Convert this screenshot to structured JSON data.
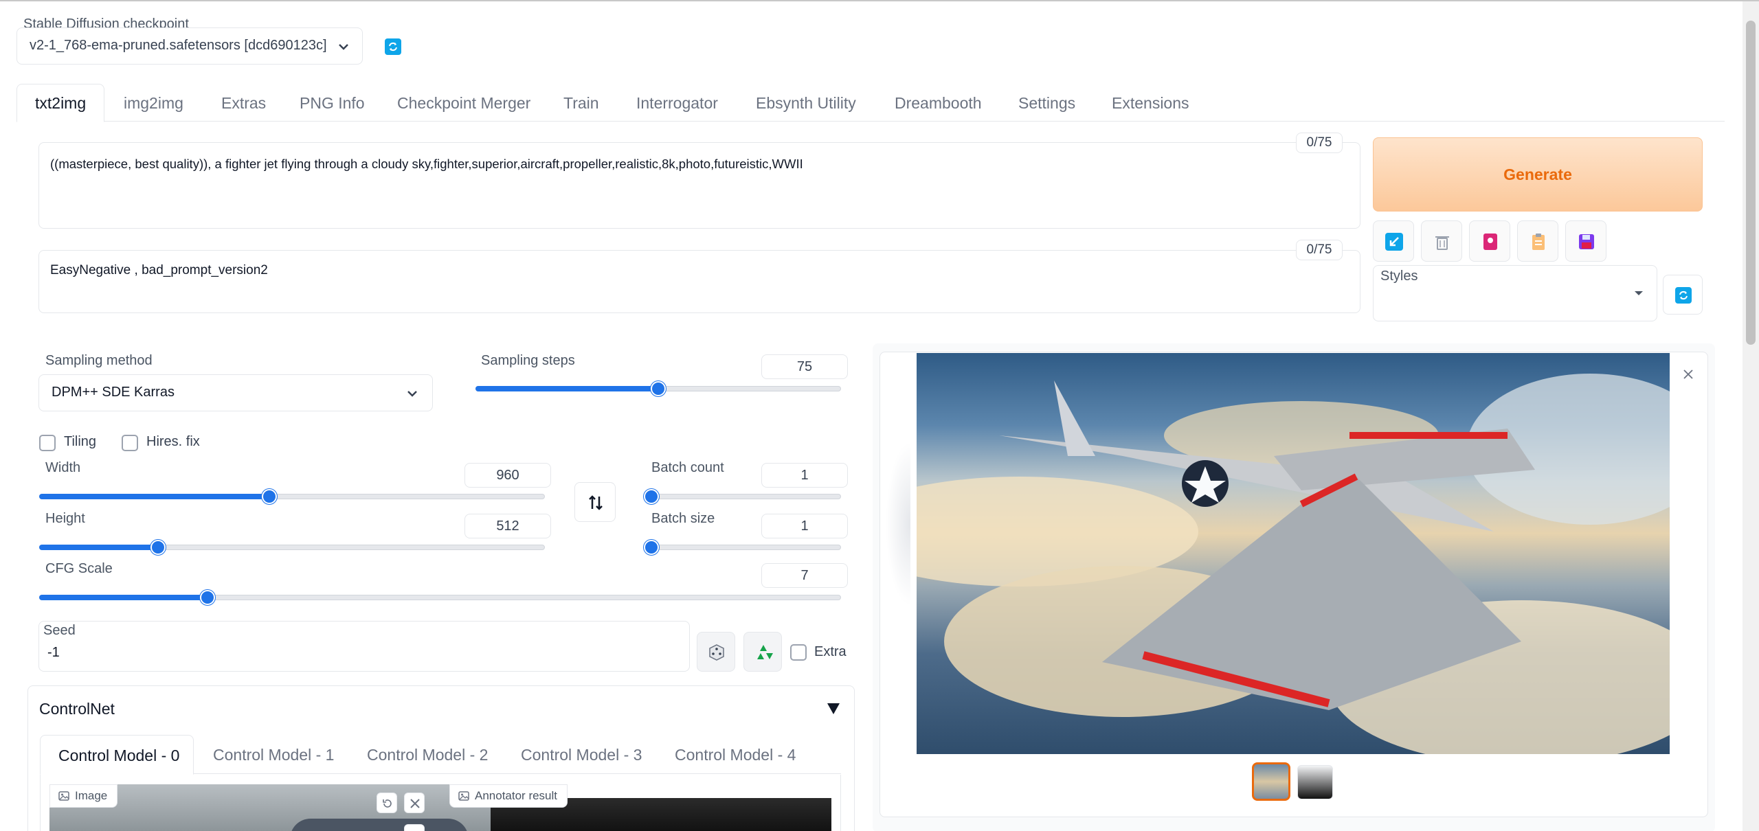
{
  "checkpoint": {
    "label": "Stable Diffusion checkpoint",
    "value": "v2-1_768-ema-pruned.safetensors [dcd690123c]"
  },
  "tabs": [
    "txt2img",
    "img2img",
    "Extras",
    "PNG Info",
    "Checkpoint Merger",
    "Train",
    "Interrogator",
    "Ebsynth Utility",
    "Dreambooth",
    "Settings",
    "Extensions"
  ],
  "prompt": {
    "text": "((masterpiece, best quality)), a fighter jet flying through a cloudy sky,fighter,superior,aircraft,propeller,realistic,8k,photo,futureistic,WWII",
    "counter": "0/75"
  },
  "negative_prompt": {
    "text": "EasyNegative , bad_prompt_version2",
    "counter": "0/75"
  },
  "generate_label": "Generate",
  "styles_label": "Styles",
  "sampling": {
    "method_label": "Sampling method",
    "method_value": "DPM++ SDE Karras",
    "steps_label": "Sampling steps",
    "steps_value": "75",
    "steps_fraction": 0.5
  },
  "tiling_label": "Tiling",
  "hires_label": "Hires. fix",
  "width": {
    "label": "Width",
    "value": "960",
    "fraction": 0.455
  },
  "height": {
    "label": "Height",
    "value": "512",
    "fraction": 0.235
  },
  "batch_count": {
    "label": "Batch count",
    "value": "1",
    "fraction": 0.0
  },
  "batch_size": {
    "label": "Batch size",
    "value": "1",
    "fraction": 0.0
  },
  "cfg": {
    "label": "CFG Scale",
    "value": "7",
    "fraction": 0.21
  },
  "seed": {
    "label": "Seed",
    "value": "-1",
    "extra_label": "Extra"
  },
  "controlnet": {
    "title": "ControlNet",
    "tabs": [
      "Control Model - 0",
      "Control Model - 1",
      "Control Model - 2",
      "Control Model - 3",
      "Control Model - 4"
    ],
    "image_label": "Image",
    "annotator_label": "Annotator result"
  },
  "colors": {
    "accent": "#1f73e8",
    "generate_bg": "#fdd9b8",
    "generate_text": "#ea6a0c",
    "selected_thumb": "#ea6a0c"
  }
}
